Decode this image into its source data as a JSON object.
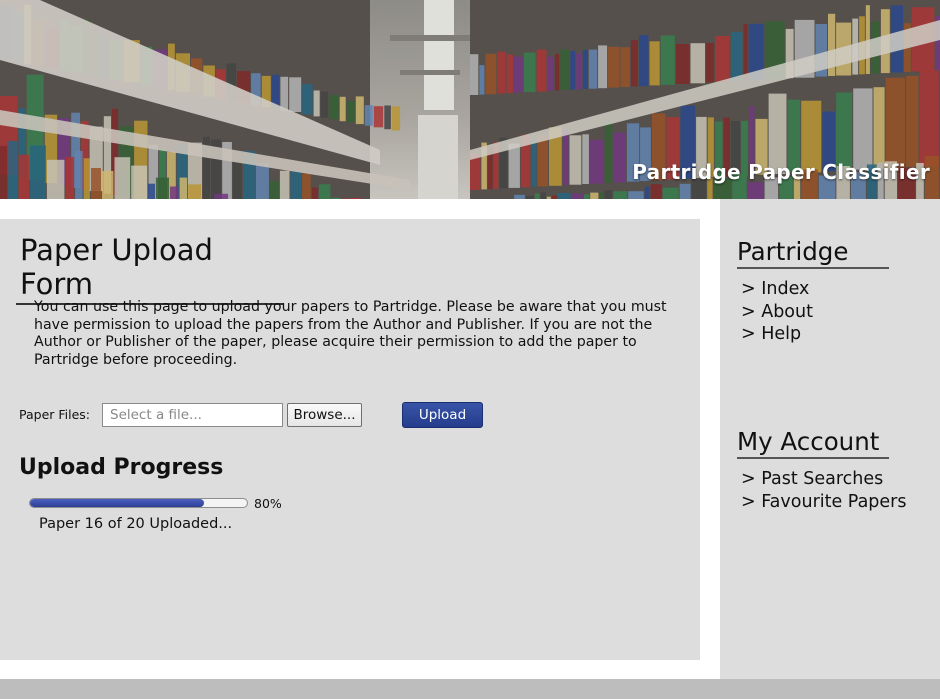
{
  "header": {
    "site_title": "Partridge Paper Classifier"
  },
  "main": {
    "title": "Paper Upload Form",
    "intro": "You can use this page to upload your papers to Partridge. Please be aware that you must have permission to upload the papers from the Author and Publisher. If you are not the Author or Publisher of the paper, please acquire their permission to add the paper to Partridge before proceeding.",
    "upload": {
      "files_label": "Paper Files:",
      "file_placeholder": "Select a file...",
      "browse_label": "Browse...",
      "upload_label": "Upload"
    },
    "progress": {
      "heading": "Upload Progress",
      "value": 80,
      "percent_label": "80%",
      "status": "Paper 16 of 20 Uploaded..."
    }
  },
  "sidebar": {
    "sections": [
      {
        "heading": "Partridge",
        "items": [
          "> Index",
          "> About",
          "> Help"
        ]
      },
      {
        "heading": "My Account",
        "items": [
          "> Past Searches",
          "> Favourite Papers"
        ]
      }
    ]
  },
  "colors": {
    "panel_bg": "#dddddd",
    "footer_bg": "#bdbdbd",
    "upload_button": "#2b4494",
    "progress_fill": "#3a4eab"
  }
}
